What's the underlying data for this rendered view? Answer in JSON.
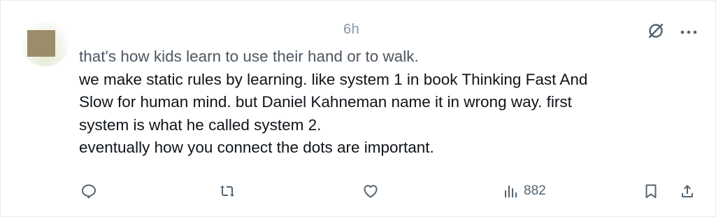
{
  "post": {
    "time": "6h",
    "lines": [
      "that's how kids learn to use their hand or to walk.",
      "we make static rules by learning. like system 1 in book Thinking Fast And",
      "Slow for human mind. but Daniel Kahneman name it in wrong way. first",
      "system is what he called system 2.",
      "eventually how you connect the dots are important."
    ],
    "views": "882"
  },
  "icons": {
    "grok": "grok-slash-icon",
    "more": "more-dots-icon",
    "reply": "reply-icon",
    "repost": "repost-icon",
    "like": "like-icon",
    "views": "views-icon",
    "bookmark": "bookmark-icon",
    "share": "share-icon"
  },
  "colors": {
    "text": "#0f1419",
    "muted": "#536471",
    "time": "#8b98a5"
  }
}
